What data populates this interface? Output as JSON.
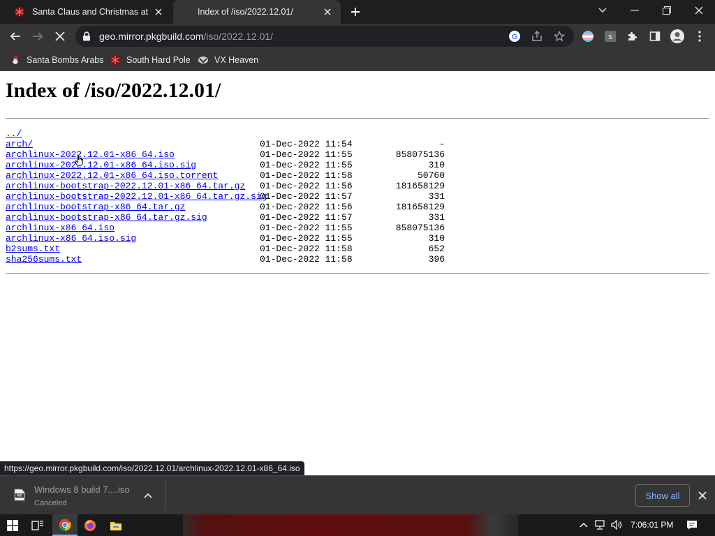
{
  "browser": {
    "tabs": [
      {
        "title": "Santa Claus and Christmas at the",
        "favicon": "red-snowflake-icon",
        "active": false
      },
      {
        "title": "Index of /iso/2022.12.01/",
        "active": true
      }
    ],
    "address": {
      "host": "geo.mirror.pkgbuild.com",
      "path": "/iso/2022.12.01/"
    },
    "bookmarks": [
      {
        "label": "Santa Bombs Arabs",
        "icon": "santa-icon"
      },
      {
        "label": "South Hard Pole",
        "icon": "red-snowflake-icon"
      },
      {
        "label": "VX Heaven",
        "icon": "vx-heaven-icon"
      }
    ]
  },
  "page": {
    "heading": "Index of /iso/2022.12.01/",
    "entries": [
      {
        "name": "../",
        "date": "",
        "size": ""
      },
      {
        "name": "arch/",
        "date": "01-Dec-2022 11:54",
        "size": "-"
      },
      {
        "name": "archlinux-2022.12.01-x86_64.iso",
        "date": "01-Dec-2022 11:55",
        "size": "858075136"
      },
      {
        "name": "archlinux-2022.12.01-x86_64.iso.sig",
        "date": "01-Dec-2022 11:55",
        "size": "310"
      },
      {
        "name": "archlinux-2022.12.01-x86_64.iso.torrent",
        "date": "01-Dec-2022 11:58",
        "size": "50760"
      },
      {
        "name": "archlinux-bootstrap-2022.12.01-x86_64.tar.gz",
        "date": "01-Dec-2022 11:56",
        "size": "181658129"
      },
      {
        "name": "archlinux-bootstrap-2022.12.01-x86_64.tar.gz.sig",
        "date": "01-Dec-2022 11:57",
        "size": "331"
      },
      {
        "name": "archlinux-bootstrap-x86_64.tar.gz",
        "date": "01-Dec-2022 11:56",
        "size": "181658129"
      },
      {
        "name": "archlinux-bootstrap-x86_64.tar.gz.sig",
        "date": "01-Dec-2022 11:57",
        "size": "331"
      },
      {
        "name": "archlinux-x86_64.iso",
        "date": "01-Dec-2022 11:55",
        "size": "858075136"
      },
      {
        "name": "archlinux-x86_64.iso.sig",
        "date": "01-Dec-2022 11:55",
        "size": "310"
      },
      {
        "name": "b2sums.txt",
        "date": "01-Dec-2022 11:58",
        "size": "652"
      },
      {
        "name": "sha256sums.txt",
        "date": "01-Dec-2022 11:58",
        "size": "396"
      }
    ]
  },
  "status_bubble": "https://geo.mirror.pkgbuild.com/iso/2022.12.01/archlinux-2022.12.01-x86_64.iso",
  "download_shelf": {
    "item": {
      "name": "Windows 8 build 7....iso",
      "status": "Canceled",
      "icon_label": "ISO"
    },
    "show_all_label": "Show all"
  },
  "taskbar": {
    "clock": "7:06:01 PM",
    "pinned": [
      "chrome-icon",
      "firefox-icon",
      "file-explorer-icon"
    ]
  },
  "colors": {
    "link": "#0000ee",
    "chrome_dark": "#353535",
    "tabstrip": "#1e1e1e",
    "accent_blue": "#8ab4f8"
  }
}
